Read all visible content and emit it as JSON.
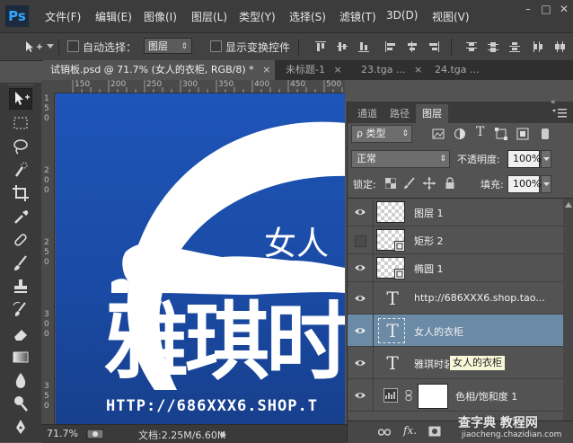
{
  "menu": {
    "logo": "Ps",
    "items": [
      "文件(F)",
      "编辑(E)",
      "图像(I)",
      "图层(L)",
      "类型(Y)",
      "选择(S)",
      "滤镜(T)",
      "3D(D)",
      "视图(V)"
    ],
    "window_controls": [
      "–",
      "□",
      "✕"
    ]
  },
  "options": {
    "auto_select_label": "自动选择：",
    "auto_select_value": "图层",
    "show_transform_label": "显示变换控件"
  },
  "tabs": [
    {
      "label": "试销板.psd @ 71.7% (女人的衣柜, RGB/8) *",
      "close": "×"
    },
    {
      "label": "未标题-1",
      "close": "×"
    },
    {
      "label": "23.tga ...",
      "close": "×"
    },
    {
      "label": "24.tga ...",
      "close": ""
    }
  ],
  "ruler": {
    "h_ticks": [
      "150",
      "200",
      "250",
      "300",
      "350",
      "400",
      "450",
      "500"
    ],
    "v_ticks": [
      "1",
      "5",
      "0",
      "2",
      "0",
      "0",
      "2",
      "5",
      "0",
      "3",
      "0",
      "0",
      "3",
      "5",
      "0"
    ]
  },
  "canvas": {
    "script_text": "女人",
    "big_text": "雅琪时",
    "url_text": "HTTP://686XXX6.SHOP.T"
  },
  "status": {
    "zoom": "71.7%",
    "doc_info": "文档:2.25M/6.60M"
  },
  "panel": {
    "tabs": [
      "通道",
      "路径",
      "图层"
    ],
    "filter_label": "ρ 类型",
    "blend_mode": "正常",
    "opacity_label": "不透明度:",
    "opacity_value": "100%",
    "lock_label": "锁定:",
    "fill_label": "填充:",
    "fill_value": "100%",
    "layers": [
      {
        "name": "图层 1",
        "kind": "pixel",
        "visible": true
      },
      {
        "name": "矩形 2",
        "kind": "shape",
        "visible": false
      },
      {
        "name": "椭圆 1",
        "kind": "shape",
        "visible": true
      },
      {
        "name": "http://686XXX6.shop.tao...",
        "kind": "text",
        "visible": true
      },
      {
        "name": "女人的衣柜",
        "kind": "text",
        "visible": true,
        "selected": true
      },
      {
        "name": "雅琪时装",
        "kind": "text",
        "visible": true
      },
      {
        "name": "色相/饱和度 1",
        "kind": "adjustment",
        "visible": true
      }
    ],
    "tooltip": "女人的衣柜",
    "bottom_icons": [
      "link-icon",
      "fx-icon"
    ]
  },
  "watermark": {
    "line1": "查字典 教程网",
    "line2": "jiaocheng.chazidian.com"
  },
  "colors": {
    "canvas_blue": "#1e55b8",
    "selected_layer": "#6b8aa6",
    "ps_blue": "#31a8ff"
  }
}
